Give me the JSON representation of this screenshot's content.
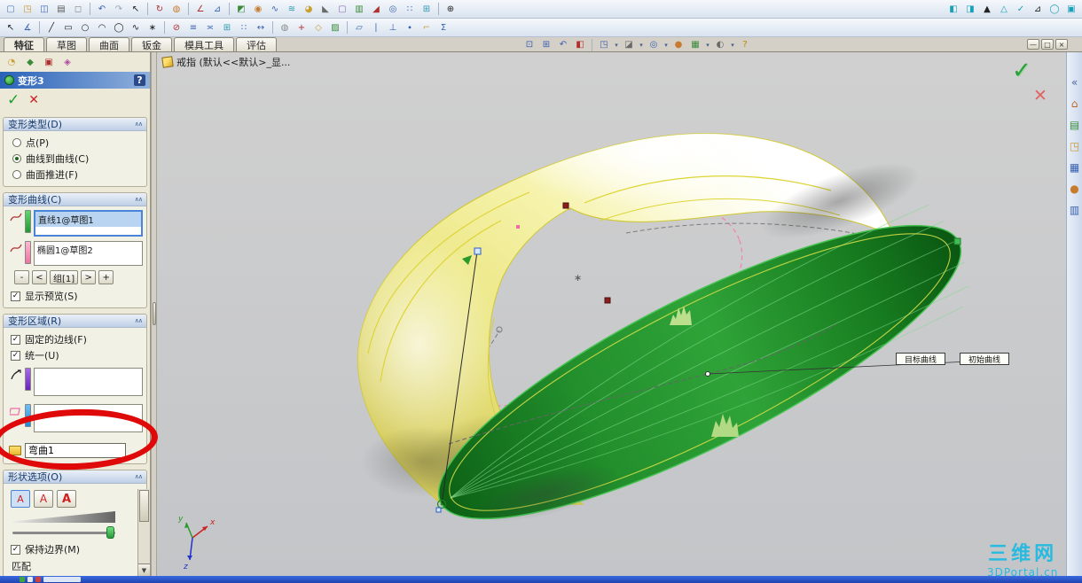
{
  "tabs": {
    "items": [
      {
        "label": "特征",
        "active": true
      },
      {
        "label": "草图",
        "active": false
      },
      {
        "label": "曲面",
        "active": false
      },
      {
        "label": "钣金",
        "active": false
      },
      {
        "label": "模具工具",
        "active": false
      },
      {
        "label": "评估",
        "active": false
      }
    ]
  },
  "window_controls": {
    "minimize": "—",
    "restore": "□",
    "close": "×"
  },
  "toolbar_row1": [
    {
      "name": "new-document-icon",
      "glyph": "▢",
      "color": "#4a7ab5"
    },
    {
      "name": "open-icon",
      "glyph": "◳",
      "color": "#c8972e"
    },
    {
      "name": "save-icon",
      "glyph": "◫",
      "color": "#3a62b0"
    },
    {
      "name": "print-icon",
      "glyph": "▤",
      "color": "#5a5a5a"
    },
    {
      "name": "print-preview-icon",
      "glyph": "◻",
      "color": "#8a8a8a"
    },
    {
      "sep": true
    },
    {
      "name": "undo-icon",
      "glyph": "↶",
      "color": "#3a62b0"
    },
    {
      "name": "redo-icon",
      "glyph": "↷",
      "color": "#9aa6b8"
    },
    {
      "name": "select-icon",
      "glyph": "↖",
      "color": "#222222"
    },
    {
      "sep": true
    },
    {
      "name": "rebuild-icon",
      "glyph": "↻",
      "color": "#b03030"
    },
    {
      "name": "edit-color-icon",
      "glyph": "◍",
      "color": "#c87a2e"
    },
    {
      "sep": true
    },
    {
      "name": "sketch-icon",
      "glyph": "∠",
      "color": "#b03030"
    },
    {
      "name": "3d-sketch-icon",
      "glyph": "⊿",
      "color": "#3a62b0"
    },
    {
      "sep": true
    },
    {
      "name": "extrude-icon",
      "glyph": "◩",
      "color": "#3a8a3a"
    },
    {
      "name": "revolve-icon",
      "glyph": "◉",
      "color": "#c87a2e"
    },
    {
      "name": "sweep-icon",
      "glyph": "∿",
      "color": "#3a62b0"
    },
    {
      "name": "loft-icon",
      "glyph": "≋",
      "color": "#2e9ab0"
    },
    {
      "name": "fillet-icon",
      "glyph": "◕",
      "color": "#c8a030"
    },
    {
      "name": "chamfer-icon",
      "glyph": "◣",
      "color": "#6a6a6a"
    },
    {
      "name": "shell-icon",
      "glyph": "▢",
      "color": "#8a6ab0"
    },
    {
      "name": "rib-icon",
      "glyph": "▥",
      "color": "#3a8a3a"
    },
    {
      "name": "draft-icon",
      "glyph": "◢",
      "color": "#b03030"
    },
    {
      "name": "hole-wizard-icon",
      "glyph": "◎",
      "color": "#3a62b0"
    },
    {
      "name": "linear-pattern-icon",
      "glyph": "∷",
      "color": "#3a62b0"
    },
    {
      "name": "mirror-icon",
      "glyph": "⊞",
      "color": "#2e9ab0"
    },
    {
      "sep": true
    },
    {
      "name": "zoom-icon",
      "glyph": "⊕",
      "color": "#222222"
    },
    {
      "spacer": true
    },
    {
      "name": "annotation-table-icon",
      "glyph": "◧",
      "color": "#18a0b8"
    },
    {
      "name": "bom-table-icon",
      "glyph": "◨",
      "color": "#18a0b8"
    },
    {
      "name": "datum-icon",
      "glyph": "▲",
      "color": "#222222"
    },
    {
      "name": "tolerance-icon",
      "glyph": "△",
      "color": "#18a0b8"
    },
    {
      "name": "surface-finish-icon",
      "glyph": "✓",
      "color": "#18a0b8"
    },
    {
      "name": "weld-symbol-icon",
      "glyph": "⊿",
      "color": "#222222"
    },
    {
      "name": "balloon-icon",
      "glyph": "◯",
      "color": "#18a0b8"
    },
    {
      "name": "revision-icon",
      "glyph": "▣",
      "color": "#18a0b8"
    }
  ],
  "toolbar_row2": [
    {
      "name": "sketch-select-icon",
      "glyph": "↖",
      "color": "#222222"
    },
    {
      "name": "smart-dimension-icon",
      "glyph": "∡",
      "color": "#3a62b0"
    },
    {
      "sep": true
    },
    {
      "name": "line-icon",
      "glyph": "╱",
      "color": "#222222"
    },
    {
      "name": "rectangle-icon",
      "glyph": "▭",
      "color": "#222222"
    },
    {
      "name": "circle-icon",
      "glyph": "○",
      "color": "#222222"
    },
    {
      "name": "arc-icon",
      "glyph": "◠",
      "color": "#222222"
    },
    {
      "name": "ellipse-icon",
      "glyph": "◯",
      "color": "#222222"
    },
    {
      "name": "spline-icon",
      "glyph": "∿",
      "color": "#222222"
    },
    {
      "name": "point-icon",
      "glyph": "∗",
      "color": "#222222"
    },
    {
      "sep": true
    },
    {
      "name": "trim-icon",
      "glyph": "⊘",
      "color": "#b03030"
    },
    {
      "name": "convert-entities-icon",
      "glyph": "≡",
      "color": "#3a62b0"
    },
    {
      "name": "offset-entities-icon",
      "glyph": "≍",
      "color": "#3a62b0"
    },
    {
      "name": "mirror-entities-icon",
      "glyph": "⊞",
      "color": "#2e9ab0"
    },
    {
      "name": "sketch-pattern-icon",
      "glyph": "∷",
      "color": "#3a62b0"
    },
    {
      "name": "move-entities-icon",
      "glyph": "↔",
      "color": "#3a62b0"
    },
    {
      "sep": true
    },
    {
      "name": "display-delete-icon",
      "glyph": "◍",
      "color": "#8a8a8a"
    },
    {
      "name": "repair-sketch-icon",
      "glyph": "+",
      "color": "#b03030"
    },
    {
      "name": "quick-snaps-icon",
      "glyph": "◇",
      "color": "#c8a030"
    },
    {
      "name": "rapid-sketch-icon",
      "glyph": "▨",
      "color": "#3a8a3a"
    },
    {
      "sep": true
    },
    {
      "name": "reference-plane-icon",
      "glyph": "▱",
      "color": "#3a62b0"
    },
    {
      "name": "reference-axis-icon",
      "glyph": "∣",
      "color": "#3a62b0"
    },
    {
      "name": "coordinate-system-icon",
      "glyph": "⊥",
      "color": "#3a62b0"
    },
    {
      "name": "reference-point-icon",
      "glyph": "∙",
      "color": "#3a62b0"
    },
    {
      "name": "measure-tool-icon",
      "glyph": "⌐",
      "color": "#c8a030"
    },
    {
      "name": "mass-properties-icon",
      "glyph": "Σ",
      "color": "#3a62b0"
    }
  ],
  "headsup": [
    {
      "name": "zoom-fit-icon",
      "glyph": "⊡",
      "color": "#3a62b0"
    },
    {
      "name": "zoom-area-icon",
      "glyph": "⊞",
      "color": "#3a62b0"
    },
    {
      "name": "previous-view-icon",
      "glyph": "↶",
      "color": "#3a62b0"
    },
    {
      "name": "section-view-icon",
      "glyph": "◧",
      "color": "#b03030"
    },
    {
      "sep": true
    },
    {
      "name": "view-orientation-icon",
      "glyph": "◳",
      "color": "#3a62b0",
      "dd": true
    },
    {
      "name": "display-style-icon",
      "glyph": "◪",
      "color": "#6a6a6a",
      "dd": true
    },
    {
      "name": "hide-show-items-icon",
      "glyph": "◎",
      "color": "#3a62b0",
      "dd": true
    },
    {
      "name": "edit-appearance-icon",
      "glyph": "●",
      "color": "#c87a2e"
    },
    {
      "name": "apply-scene-icon",
      "glyph": "▦",
      "color": "#3a8a3a",
      "dd": true
    },
    {
      "name": "view-settings-icon",
      "glyph": "◐",
      "color": "#6a6a6a",
      "dd": true
    },
    {
      "name": "help-icon",
      "glyph": "?",
      "color": "#b58a00"
    }
  ],
  "pm_tabs": [
    {
      "name": "pm-properties-tab-icon",
      "glyph": "◔",
      "color": "#c8a030"
    },
    {
      "name": "pm-configuration-tab-icon",
      "glyph": "◆",
      "color": "#3a8a3a"
    },
    {
      "name": "pm-display-tab-icon",
      "glyph": "▣",
      "color": "#b03030"
    },
    {
      "name": "pm-dimxpert-tab-icon",
      "glyph": "◈",
      "color": "#b04aa0"
    }
  ],
  "taskpane": [
    {
      "name": "taskpane-collapse-icon",
      "glyph": "«",
      "color": "#4a6a9a"
    },
    {
      "name": "resources-home-icon",
      "glyph": "⌂",
      "color": "#c06820"
    },
    {
      "name": "design-library-icon",
      "glyph": "▤",
      "color": "#3a8a3a"
    },
    {
      "name": "file-explorer-icon",
      "glyph": "◳",
      "color": "#c8972e"
    },
    {
      "name": "view-palette-icon",
      "glyph": "▦",
      "color": "#3a62b0"
    },
    {
      "name": "appearances-icon",
      "glyph": "●",
      "color": "#c87a2e"
    },
    {
      "name": "custom-properties-icon",
      "glyph": "▥",
      "color": "#3a62b0"
    }
  ],
  "pm": {
    "title": "变形3",
    "help": "?",
    "ok": "✓",
    "cancel": "✕",
    "type": {
      "header": "变形类型(D)",
      "options": [
        {
          "label": "点(P)",
          "selected": false
        },
        {
          "label": "曲线到曲线(C)",
          "selected": true
        },
        {
          "label": "曲面推进(F)",
          "selected": false
        }
      ]
    },
    "curves": {
      "header": "变形曲线(C)",
      "items": [
        "直线1@草图1",
        "椭圆1@草图2"
      ],
      "buttons": [
        "-",
        "<",
        "组[1]",
        ">",
        "+"
      ],
      "show_preview": "显示预览(S)"
    },
    "region": {
      "header": "变形区域(R)",
      "fixed_edges": "固定的边线(F)",
      "uniform": "统一(U)",
      "body_name": "弯曲1"
    },
    "shape": {
      "header": "形状选项(O)",
      "stiffness": [
        "A",
        "A",
        "A"
      ],
      "keep_boundary": "保持边界(M)",
      "match": "匹配"
    }
  },
  "viewport": {
    "doc_hint": "戒指 (默认<<默认>_显...",
    "callouts": {
      "target": "目标曲线",
      "initial": "初始曲线"
    },
    "confirm": {
      "ok": "✓",
      "cancel": "✕"
    },
    "triad": {
      "x": "x",
      "y": "y",
      "z": "z"
    },
    "watermark": {
      "title": "三维网",
      "subtitle": "3DPortal.cn"
    }
  },
  "statusbar": {
    "items": [
      {
        "name": "taskbar-item-green",
        "color": "#3fa53f",
        "w": 6
      },
      {
        "name": "taskbar-item-white",
        "color": "#e8e8e8",
        "w": 6
      },
      {
        "name": "taskbar-item-red",
        "color": "#d04040",
        "w": 6
      },
      {
        "name": "taskbar-quicklaunch",
        "color": "#dce6f4",
        "w": 42
      }
    ]
  },
  "colors": {
    "accent_blue": "#2a62b8",
    "annotation_red": "#e00909",
    "target_face_green": "#2fa338",
    "preview_surface_yellow": "#f0ec9c",
    "watermark_cyan": "#18b9e2"
  }
}
